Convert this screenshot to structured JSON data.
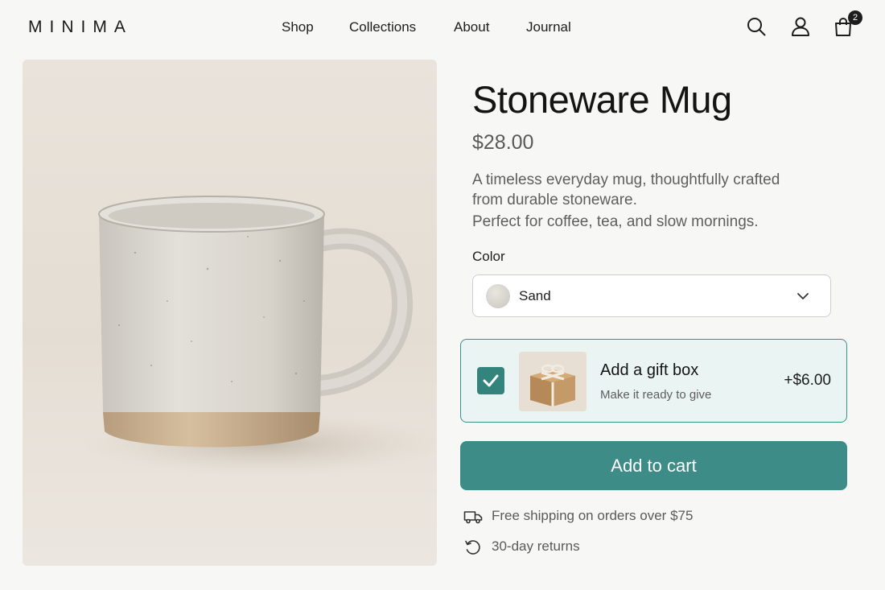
{
  "brand": {
    "logo": "MINIMA"
  },
  "nav": {
    "items": [
      {
        "label": "Shop"
      },
      {
        "label": "Collections"
      },
      {
        "label": "About"
      },
      {
        "label": "Journal"
      }
    ]
  },
  "header_icons": {
    "search": "search-icon",
    "account": "user-icon",
    "cart": "shopping-bag-icon",
    "cart_count": "2"
  },
  "product": {
    "image_alt": "Speckled stoneware mug",
    "title": "Stoneware Mug",
    "price": "$28.00",
    "description": [
      "A timeless everyday mug, thoughtfully crafted",
      "from durable stoneware.",
      "Perfect for coffee, tea, and slow mornings."
    ]
  },
  "options": {
    "color_label": "Color",
    "color_value": "Sand"
  },
  "gift_box": {
    "checked": true,
    "title": "Add a gift box",
    "subtitle": "Make it ready to give",
    "price": "+$6.00"
  },
  "actions": {
    "add_to_cart": "Add to cart"
  },
  "perks": [
    {
      "icon": "truck-icon",
      "text": "Free shipping on orders over $75"
    },
    {
      "icon": "returns-icon",
      "text": "30-day returns"
    }
  ],
  "colors": {
    "accent": "#3d8c87",
    "gift_bg": "#eaf4f2",
    "gift_border": "#3b9088"
  }
}
